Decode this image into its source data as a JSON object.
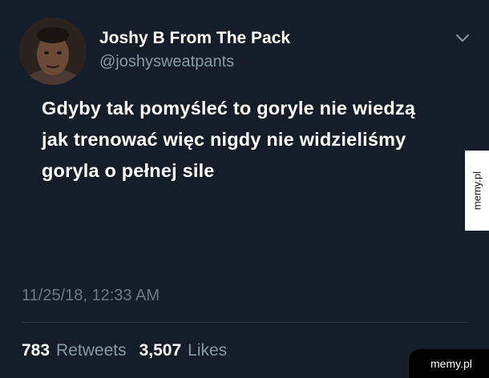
{
  "tweet": {
    "display_name": "Joshy B From The Pack",
    "handle": "@joshysweatpants",
    "text": "Gdyby tak pomyśleć to goryle nie wiedzą jak trenować więc nigdy nie widzieliśmy goryla o pełnej sile",
    "timestamp": "11/25/18, 12:33 AM",
    "retweets_count": "783",
    "retweets_label": "Retweets",
    "likes_count": "3,507",
    "likes_label": "Likes"
  },
  "icons": {
    "menu": "chevron-down-icon",
    "avatar": "user-avatar"
  },
  "watermarks": {
    "side": "memy.pl",
    "corner": "memy.pl"
  },
  "colors": {
    "background": "#151d28",
    "primary_text": "#ffffff",
    "secondary_text": "#8899a6",
    "timestamp": "#6b7a88"
  }
}
